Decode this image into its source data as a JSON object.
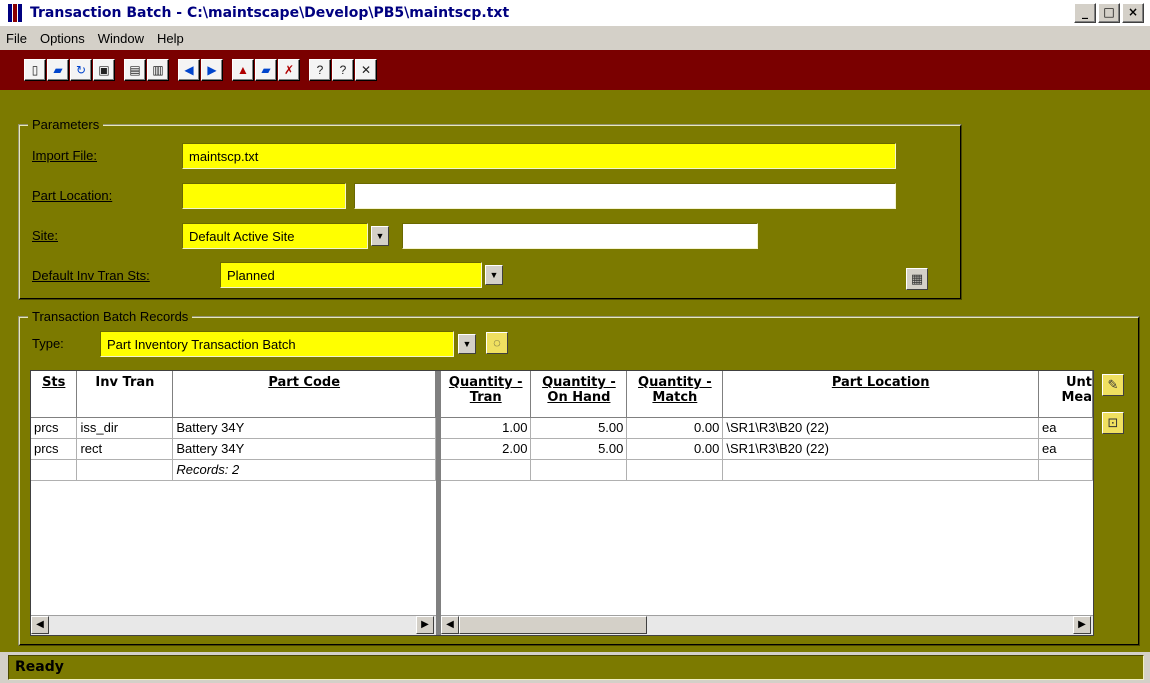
{
  "window": {
    "title": "Transaction Batch - C:\\maintscape\\Develop\\PB5\\maintscp.txt",
    "minimize": "_",
    "maximize": "□",
    "close": "×"
  },
  "menu": [
    "File",
    "Options",
    "Window",
    "Help"
  ],
  "parameters": {
    "legend": "Parameters",
    "import_file_label": "Import File:",
    "import_file_value": "maintscp.txt",
    "part_location_label": "Part Location:",
    "part_location_code": "",
    "part_location_desc": "",
    "site_label": "Site:",
    "site_value": "Default Active Site",
    "site_desc": "",
    "default_sts_label": "Default Inv Tran Sts:",
    "default_sts_value": "Planned"
  },
  "records": {
    "legend": "Transaction Batch Records",
    "type_label": "Type:",
    "type_value": "Part Inventory Transaction Batch"
  },
  "grid": {
    "left_headers": [
      "Sts",
      "Inv Tran",
      "Part Code"
    ],
    "right_headers": [
      [
        "Quantity -",
        "Tran"
      ],
      [
        "Quantity -",
        "On Hand"
      ],
      [
        "Quantity -",
        "Match"
      ],
      [
        "Part Location",
        ""
      ],
      [
        "Unt",
        "Mea"
      ]
    ],
    "rows": [
      {
        "sts": "prcs",
        "inv_tran": "iss_dir",
        "part_code": "Battery 34Y",
        "qty_tran": "1.00",
        "qty_on_hand": "5.00",
        "qty_match": "0.00",
        "part_location": "\\SR1\\R3\\B20 (22)",
        "uom": "ea"
      },
      {
        "sts": "prcs",
        "inv_tran": "rect",
        "part_code": "Battery 34Y",
        "qty_tran": "2.00",
        "qty_on_hand": "5.00",
        "qty_match": "0.00",
        "part_location": "\\SR1\\R3\\B20 (22)",
        "uom": "ea"
      }
    ],
    "footer": "Records: 2"
  },
  "status": {
    "text": "Ready"
  },
  "colors": {
    "toolbar_bg": "#7a0000",
    "main_bg": "#7c7a00",
    "field_bg": "#ffff00"
  }
}
